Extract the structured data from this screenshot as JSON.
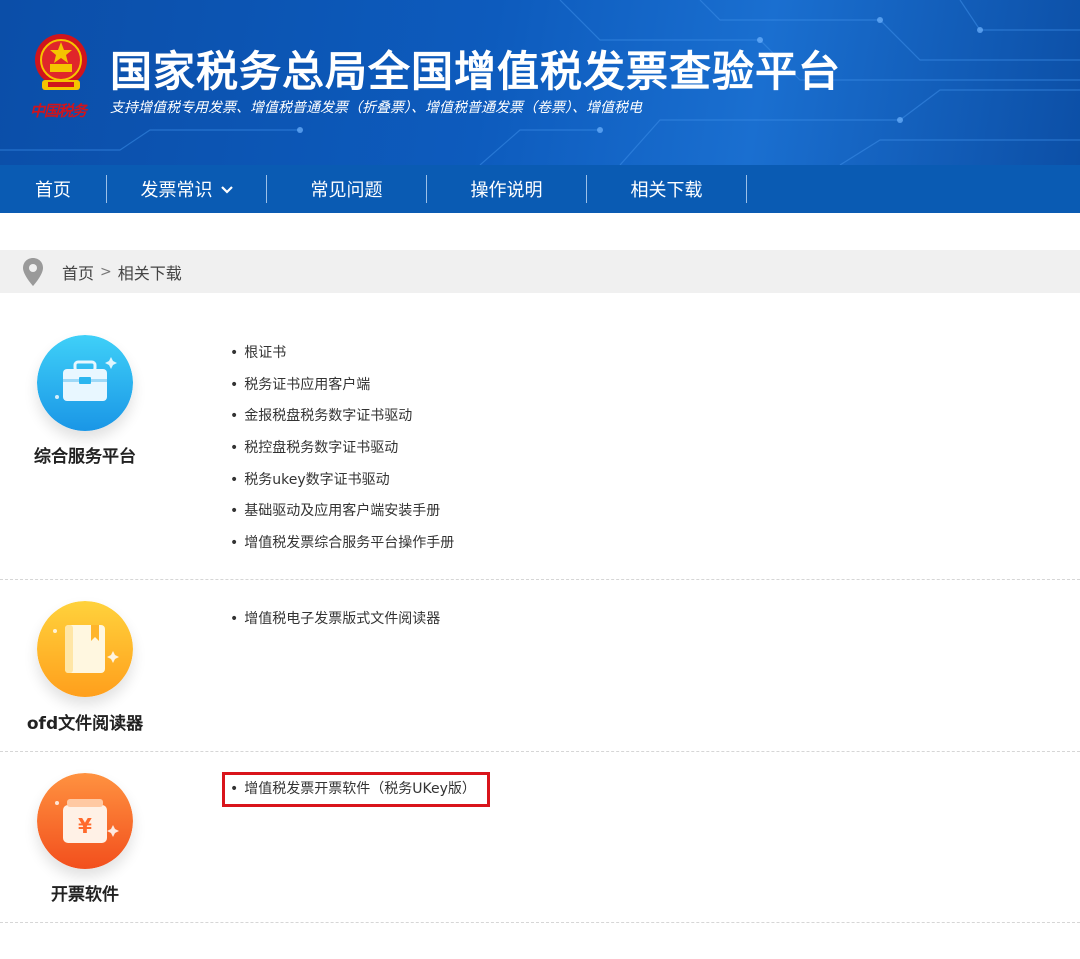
{
  "header": {
    "title": "国家税务总局全国增值税发票查验平台",
    "subtitle": "支持增值税专用发票、增值税普通发票（折叠票）、增值税普通发票（卷票）、增值税电",
    "seal_text": "中国税务",
    "banner_color": "#0b4ea8",
    "emblem_icon": "national-emblem-icon"
  },
  "nav": {
    "color": "#0a5bb3",
    "items": [
      {
        "label": "首页"
      },
      {
        "label": "发票常识",
        "has_dropdown": true,
        "icon": "chevron-down-icon"
      },
      {
        "label": "常见问题"
      },
      {
        "label": "操作说明"
      },
      {
        "label": "相关下载"
      }
    ]
  },
  "breadcrumb": {
    "icon": "location-pin-icon",
    "home": "首页",
    "separator": ">",
    "current": "相关下载"
  },
  "sections": [
    {
      "title": "综合服务平台",
      "icon": "briefcase-icon",
      "icon_color": "#2bb6ef",
      "items": [
        "根证书",
        "税务证书应用客户端",
        "金报税盘税务数字证书驱动",
        "税控盘税务数字证书驱动",
        "税务ukey数字证书驱动",
        "基础驱动及应用客户端安装手册",
        "增值税发票综合服务平台操作手册"
      ]
    },
    {
      "title": "ofd文件阅读器",
      "icon": "book-icon",
      "icon_color": "#ffb52a",
      "items": [
        "增值税电子发票版式文件阅读器"
      ]
    },
    {
      "title": "开票软件",
      "icon": "yuan-invoice-icon",
      "icon_color": "#ff6a2c",
      "items": [
        "增值税发票开票软件（税务UKey版）"
      ],
      "highlighted_item": "增值税发票开票软件（税务UKey版）",
      "highlight_color": "#d9141b"
    }
  ]
}
